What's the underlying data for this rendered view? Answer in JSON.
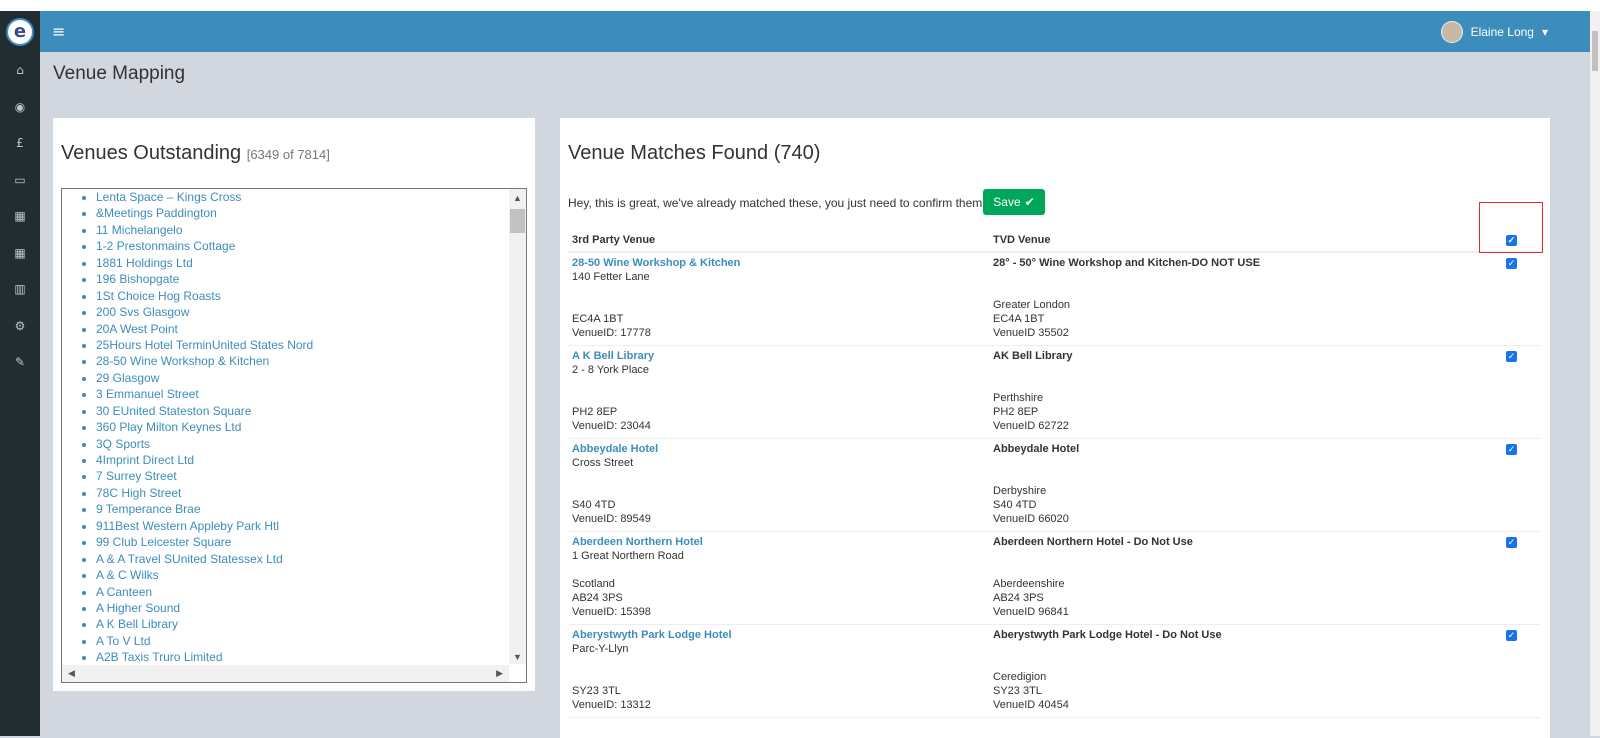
{
  "navbar": {
    "menu_icon": "bars-icon",
    "user_name": "Elaine Long",
    "caret": "▾"
  },
  "sidebar": {
    "logo_letter": "e",
    "icons": [
      "home-icon",
      "dashboard-icon",
      "pound-icon",
      "calendar-icon",
      "calendar-alt-icon",
      "calendar-grid-icon",
      "bar-chart-icon",
      "gears-icon",
      "pencil-icon"
    ],
    "glyphs": [
      "⌂",
      "◉",
      "£",
      "▭",
      "▦",
      "▦",
      "▥",
      "⚙",
      "✎"
    ]
  },
  "page": {
    "title": "Venue Mapping"
  },
  "outstanding": {
    "title": "Venues Outstanding",
    "count": "[6349 of 7814]",
    "venues": [
      "Lenta Space – Kings Cross",
      "&Meetings Paddington",
      "11 Michelangelo",
      "1-2 Prestonmains Cottage",
      "1881 Holdings Ltd",
      "196 Bishopgate",
      "1St Choice Hog Roasts",
      "200 Svs Glasgow",
      "20A West Point",
      "25Hours Hotel TerminUnited States Nord",
      "28-50 Wine Workshop & Kitchen",
      "29 Glasgow",
      "3 Emmanuel Street",
      "30 EUnited Stateston Square",
      "360 Play Milton Keynes Ltd",
      "3Q Sports",
      "4Imprint Direct Ltd",
      "7 Surrey Street",
      "78C High Street",
      "9 Temperance Brae",
      "911Best Western Appleby Park Htl",
      "99 Club Leicester Square",
      "A & A Travel SUnited Statessex Ltd",
      "A & C Wilks",
      "A Canteen",
      "A Higher Sound",
      "A K Bell Library",
      "A To V Ltd",
      "A2B Taxis Truro Limited"
    ]
  },
  "matches": {
    "title": "Venue Matches Found (740)",
    "intro": "Hey, this is great, we've already matched these, you just need to confirm them....",
    "save_label": "Save",
    "save_icon": "✔",
    "col_third_party": "3rd Party Venue",
    "col_tvd": "TVD Venue",
    "rows": [
      {
        "name": "28-50 Wine Workshop & Kitchen",
        "addr1": "140 Fetter Lane",
        "region": "",
        "postcode": "EC4A 1BT",
        "venue_id": "VenueID: 17778",
        "tvd_name": "28° - 50° Wine Workshop and Kitchen-DO NOT USE",
        "tvd_region": "Greater London",
        "tvd_postcode": "EC4A 1BT",
        "tvd_id": "VenueID 35502"
      },
      {
        "name": "A K Bell Library",
        "addr1": "2 - 8 York Place",
        "region": "",
        "postcode": "PH2 8EP",
        "venue_id": "VenueID: 23044",
        "tvd_name": "AK Bell Library",
        "tvd_region": "Perthshire",
        "tvd_postcode": "PH2 8EP",
        "tvd_id": "VenueID 62722"
      },
      {
        "name": "Abbeydale Hotel",
        "addr1": "Cross Street",
        "region": "",
        "postcode": "S40 4TD",
        "venue_id": "VenueID: 89549",
        "tvd_name": "Abbeydale Hotel",
        "tvd_region": "Derbyshire",
        "tvd_postcode": "S40 4TD",
        "tvd_id": "VenueID 66020"
      },
      {
        "name": "Aberdeen Northern Hotel",
        "addr1": "1 Great Northern Road",
        "region": "Scotland",
        "postcode": "AB24 3PS",
        "venue_id": "VenueID: 15398",
        "tvd_name": "Aberdeen Northern Hotel - Do Not Use",
        "tvd_region": "Aberdeenshire",
        "tvd_postcode": "AB24 3PS",
        "tvd_id": "VenueID 96841"
      },
      {
        "name": "Aberystwyth Park Lodge Hotel",
        "addr1": "Parc-Y-Llyn",
        "region": "",
        "postcode": "SY23 3TL",
        "venue_id": "VenueID: 13312",
        "tvd_name": "Aberystwyth Park Lodge Hotel - Do Not Use",
        "tvd_region": "Ceredigion",
        "tvd_postcode": "SY23 3TL",
        "tvd_id": "VenueID 40454"
      }
    ]
  }
}
